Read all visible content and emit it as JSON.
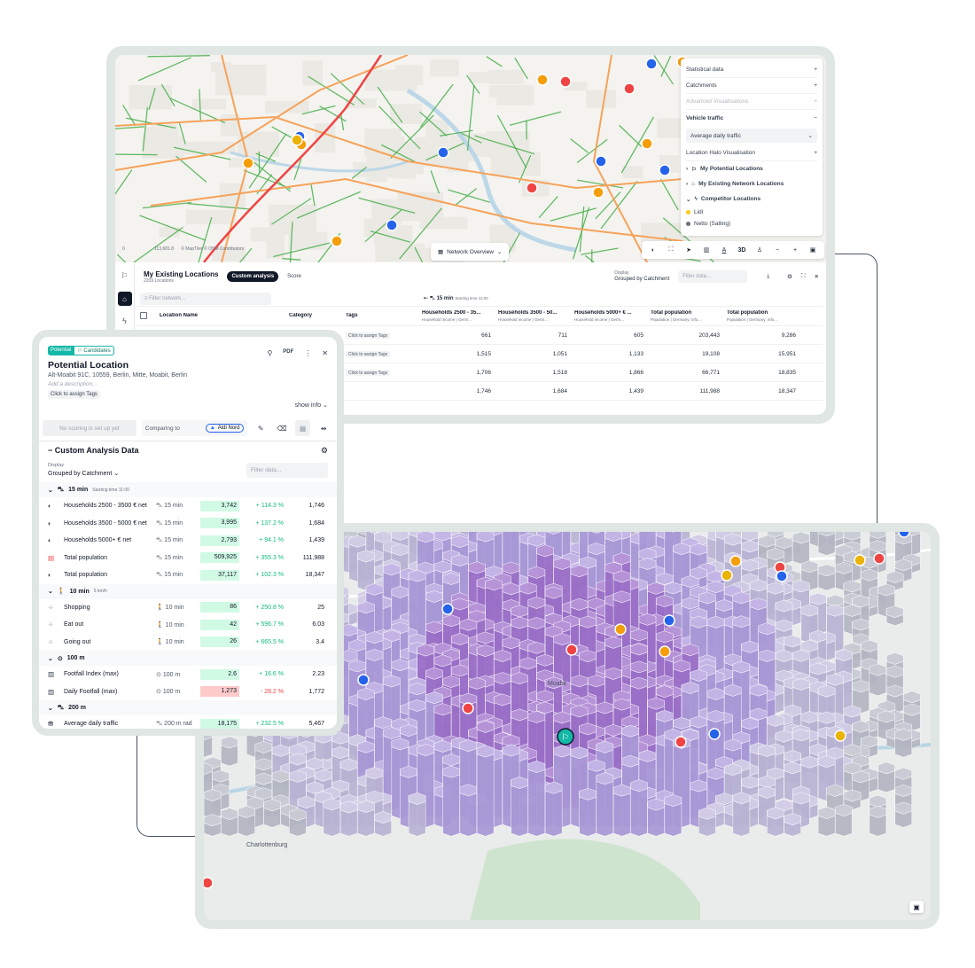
{
  "map1": {
    "scale_zero": "0",
    "scale_value": "113,681.8",
    "attribution": "© MapTiler  © OSM Contributors",
    "network_overview_label": "Network Overview",
    "layers_panel": {
      "statistical_data": "Statistical data",
      "catchments": "Catchments",
      "advanced_visualisations": "Advanced Visualisations",
      "vehicle_traffic": "Vehicle traffic",
      "traffic_select_value": "Average daily traffic",
      "location_halo": "Location Halo Visualisation",
      "my_potential_locations": "My Potential Locations",
      "my_existing_network_locations": "My Existing Network Locations",
      "competitor_locations": "Competitor Locations",
      "competitors": [
        {
          "name": "Lidl",
          "color": "#facc15"
        },
        {
          "name": "Netto (Salling)",
          "color": "#6b7280"
        }
      ]
    },
    "toolbar": {
      "three_d": "3D",
      "plus": "+",
      "minus": "−"
    }
  },
  "table": {
    "title": "My Existing Locations",
    "subtitle": "2209 Locations",
    "tab_custom": "Custom analysis",
    "tab_score": "Score",
    "display_label": "Display",
    "display_value": "Grouped by Catchment",
    "filter_placeholder": "Filter data...",
    "network_filter_placeholder": "Filter network...",
    "catchment_group": "15 min",
    "catchment_group_sub": "Starting time 11:00",
    "columns": {
      "location_name": "Location Name",
      "category": "Category",
      "tags": "Tags",
      "c1": "Households 2500 - 35...",
      "c1_sub": "Household income | Germ...",
      "c2": "Households 3500 - 50...",
      "c2_sub": "Household income | Germ...",
      "c3": "Households 5000+ € ...",
      "c3_sub": "Household income | Germ...",
      "c4": "Total population",
      "c4_sub": "Population | Germany: info...",
      "c5": "Total population",
      "c5_sub": "Population | Germany: info..."
    },
    "tag_button": "Click to assign Tags",
    "rows": [
      [
        "661",
        "711",
        "605",
        "203,443",
        "9,286"
      ],
      [
        "1,515",
        "1,051",
        "1,133",
        "19,108",
        "15,951"
      ],
      [
        "1,706",
        "1,518",
        "1,866",
        "66,771",
        "18,835"
      ],
      [
        "1,746",
        "1,684",
        "1,439",
        "111,988",
        "18,347"
      ]
    ]
  },
  "map2": {
    "label_moabit": "Moabit",
    "label_charlottenburg": "Charlottenburg"
  },
  "card": {
    "badge_potential": "Potential",
    "badge_candidates": "Candidates",
    "title": "Potential Location",
    "address": "Alt-Moabit 91C, 10559, Berlin, Mitte, Moabit, Berlin",
    "description_placeholder": "Add a description...",
    "tag_button": "Click to assign Tags",
    "show_info": "show info",
    "no_scoring": "No scoring is set up yet",
    "comparing_to": "Comparing to",
    "compare_chip": "Aldi Nord",
    "section_title": "Custom Analysis Data",
    "display_label": "Display",
    "display_value": "Grouped by Catchment",
    "filter_placeholder": "Filter data...",
    "groups": [
      {
        "label": "15 min",
        "sub": "Starting time 11:00",
        "icon": "car-icon",
        "rows": [
          {
            "icon": "income-icon",
            "name": "Households 2500 - 3500 € net",
            "time": "15 min",
            "time_icon": "car-icon",
            "value": "3,742",
            "pct": "+ 114.3 %",
            "base": "1,746",
            "neg": false
          },
          {
            "icon": "income-icon",
            "name": "Households 3500 - 5000 € net",
            "time": "15 min",
            "time_icon": "car-icon",
            "value": "3,995",
            "pct": "+ 137.2 %",
            "base": "1,684",
            "neg": false
          },
          {
            "icon": "income-icon",
            "name": "Households 5000+ € net",
            "time": "15 min",
            "time_icon": "car-icon",
            "value": "2,793",
            "pct": "+ 94.1 %",
            "base": "1,439",
            "neg": false
          },
          {
            "icon": "population-icon",
            "name": "Total population",
            "time": "15 min",
            "time_icon": "car-icon",
            "value": "509,925",
            "pct": "+ 355.3 %",
            "base": "111,988",
            "neg": false
          },
          {
            "icon": "income-icon",
            "name": "Total population",
            "time": "15 min",
            "time_icon": "car-icon",
            "value": "37,117",
            "pct": "+ 102.3 %",
            "base": "18,347",
            "neg": false
          }
        ]
      },
      {
        "label": "10 min",
        "sub": "5 km/h",
        "icon": "walk-icon",
        "rows": [
          {
            "icon": "poi-icon",
            "name": "Shopping",
            "time": "10 min",
            "time_icon": "walk-icon",
            "value": "86",
            "pct": "+ 250.8 %",
            "base": "25",
            "neg": false
          },
          {
            "icon": "poi-icon",
            "name": "Eat out",
            "time": "10 min",
            "time_icon": "walk-icon",
            "value": "42",
            "pct": "+ 596.7 %",
            "base": "6.03",
            "neg": false
          },
          {
            "icon": "poi-icon",
            "name": "Going out",
            "time": "10 min",
            "time_icon": "walk-icon",
            "value": "26",
            "pct": "+ 665.5 %",
            "base": "3.4",
            "neg": false
          }
        ]
      },
      {
        "label": "100 m",
        "sub": "",
        "icon": "radius-icon",
        "rows": [
          {
            "icon": "chart-icon",
            "name": "Footfall Index (max)",
            "time": "100 m",
            "time_icon": "radius-icon",
            "value": "2.6",
            "pct": "+ 16.6 %",
            "base": "2.23",
            "neg": false
          },
          {
            "icon": "chart-icon",
            "name": "Daily Footfall (max)",
            "time": "100 m",
            "time_icon": "radius-icon",
            "value": "1,273",
            "pct": "- 28.2 %",
            "base": "1,772",
            "neg": true
          }
        ]
      },
      {
        "label": "200 m",
        "sub": "",
        "icon": "car-icon",
        "rows": [
          {
            "icon": "traffic-icon",
            "name": "Average daily traffic",
            "time": "200 m rad",
            "time_icon": "car-icon",
            "value": "18,175",
            "pct": "+ 232.5 %",
            "base": "5,467",
            "neg": false
          }
        ]
      }
    ]
  }
}
